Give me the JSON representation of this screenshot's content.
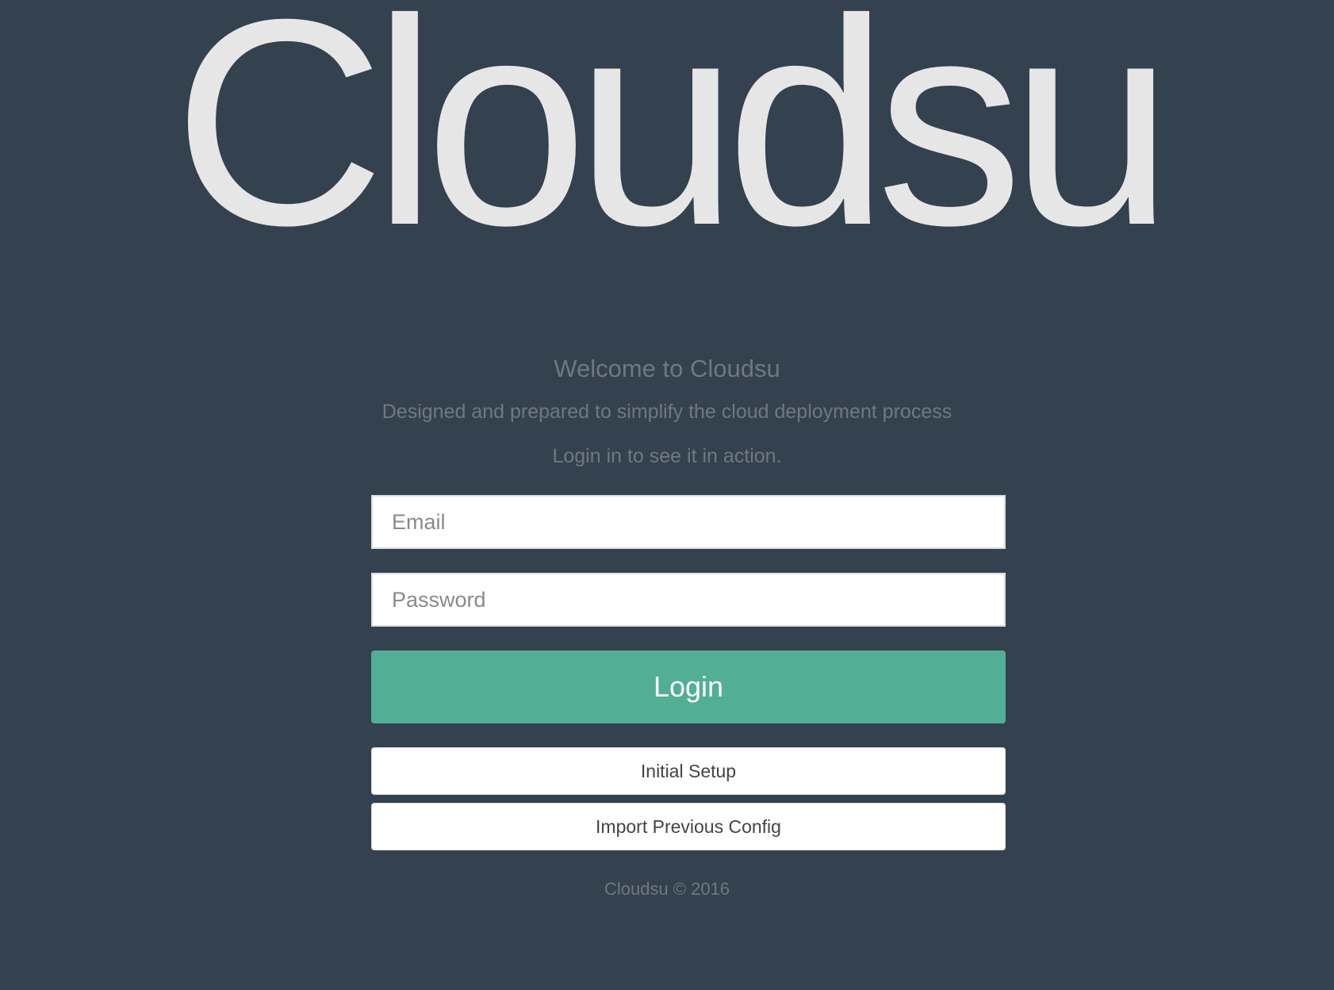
{
  "brand": {
    "logo_text": "Cloudsu"
  },
  "intro": {
    "welcome": "Welcome to Cloudsu",
    "tagline": "Designed and prepared to simplify the cloud deployment process",
    "login_hint": "Login in to see it in action."
  },
  "form": {
    "email_placeholder": "Email",
    "email_value": "",
    "password_placeholder": "Password",
    "password_value": "",
    "login_label": "Login",
    "initial_setup_label": "Initial Setup",
    "import_config_label": "Import Previous Config"
  },
  "footer": {
    "copyright": "Cloudsu © 2016"
  },
  "colors": {
    "background": "#34414f",
    "accent": "#52af95",
    "logo": "#e6e6e6",
    "muted_text": "#6f7880"
  }
}
